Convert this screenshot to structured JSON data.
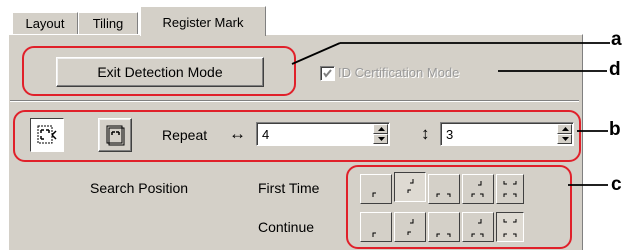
{
  "tabs": [
    {
      "label": "Layout"
    },
    {
      "label": "Tiling"
    },
    {
      "label": "Register Mark"
    }
  ],
  "exit_button": {
    "label": "Exit Detection Mode"
  },
  "id_certification": {
    "label": "ID Certification Mode",
    "checked": true
  },
  "repeat": {
    "label": "Repeat",
    "horizontal_symbol": "↔",
    "horizontal_value": "4",
    "vertical_symbol": "↕",
    "vertical_value": "3"
  },
  "search_position": {
    "label": "Search Position",
    "first_time_label": "First Time",
    "continue_label": "Continue"
  },
  "annotations": [
    "a",
    "d",
    "b",
    "c"
  ],
  "colors": {
    "panel": "#d4d0c8",
    "annotation": "#e0202a"
  }
}
